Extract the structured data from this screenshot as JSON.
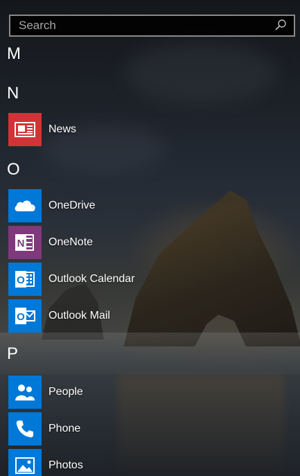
{
  "search": {
    "placeholder": "Search",
    "icon": "search-icon"
  },
  "groups": [
    {
      "letter": "M",
      "apps": []
    },
    {
      "letter": "N",
      "apps": [
        {
          "label": "News",
          "icon": "news-icon",
          "tile_color": "#d13438"
        }
      ]
    },
    {
      "letter": "O",
      "apps": [
        {
          "label": "OneDrive",
          "icon": "onedrive-icon",
          "tile_color": "#0078d7"
        },
        {
          "label": "OneNote",
          "icon": "onenote-icon",
          "tile_color": "#80397b"
        },
        {
          "label": "Outlook Calendar",
          "icon": "outlook-calendar-icon",
          "tile_color": "#0078d7"
        },
        {
          "label": "Outlook Mail",
          "icon": "outlook-mail-icon",
          "tile_color": "#0078d7"
        }
      ]
    },
    {
      "letter": "P",
      "apps": [
        {
          "label": "People",
          "icon": "people-icon",
          "tile_color": "#0078d7"
        },
        {
          "label": "Phone",
          "icon": "phone-icon",
          "tile_color": "#0078d7"
        },
        {
          "label": "Photos",
          "icon": "photos-icon",
          "tile_color": "#0078d7"
        }
      ]
    }
  ]
}
